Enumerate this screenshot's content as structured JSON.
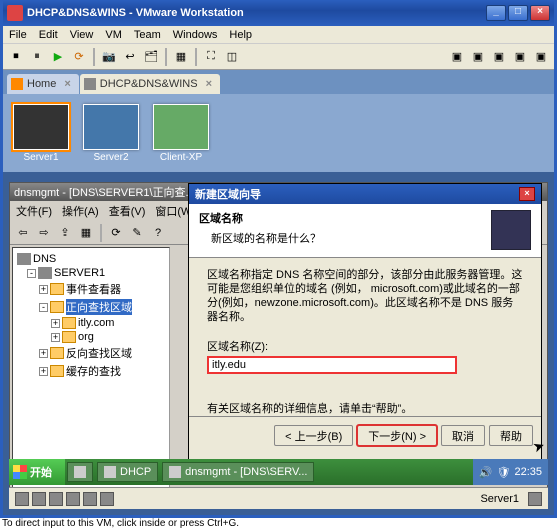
{
  "window": {
    "title": "DHCP&DNS&WINS - VMware Workstation"
  },
  "menubar": [
    "File",
    "Edit",
    "View",
    "VM",
    "Team",
    "Windows",
    "Help"
  ],
  "tabs": {
    "home": "Home",
    "vm": "DHCP&DNS&WINS"
  },
  "thumbs": [
    {
      "label": "Server1"
    },
    {
      "label": "Server2"
    },
    {
      "label": "Client-XP"
    }
  ],
  "inner": {
    "title": "dnsmgmt - [DNS\\SERVER1\\正向查...]",
    "menu": [
      "文件(F)",
      "操作(A)",
      "查看(V)",
      "窗口(W)"
    ]
  },
  "tree": {
    "root": "DNS",
    "server": "SERVER1",
    "ev": "事件查看器",
    "fwd": "正向查找区域",
    "z1": "itly.com",
    "z2": "org",
    "rev": "反向查找区域",
    "cache": "缓存的查找"
  },
  "wizard": {
    "title": "新建区域向导",
    "head_title": "区域名称",
    "head_sub": "新区域的名称是什么？",
    "desc": "区域名称指定 DNS 名称空间的部分，该部分由此服务器管理。这可能是您组织单位的域名 (例如， microsoft.com)或此域名的一部分(例如，newzone.microsoft.com)。此区域名称不是 DNS 服务器名称。",
    "label": "区域名称(Z):",
    "value": "itly.edu",
    "note": "有关区域名称的详细信息，请单击“帮助”。",
    "back": "< 上一步(B)",
    "next": "下一步(N) >",
    "cancel": "取消",
    "help": "帮助"
  },
  "start": {
    "label": "开始"
  },
  "tasks": [
    {
      "label": "DHCP"
    },
    {
      "label": "dnsmgmt - [DNS\\SERV..."
    }
  ],
  "tray": {
    "time": "22:35"
  },
  "vm_status": "Server1",
  "hint": "To direct input to this VM, click inside or press Ctrl+G."
}
